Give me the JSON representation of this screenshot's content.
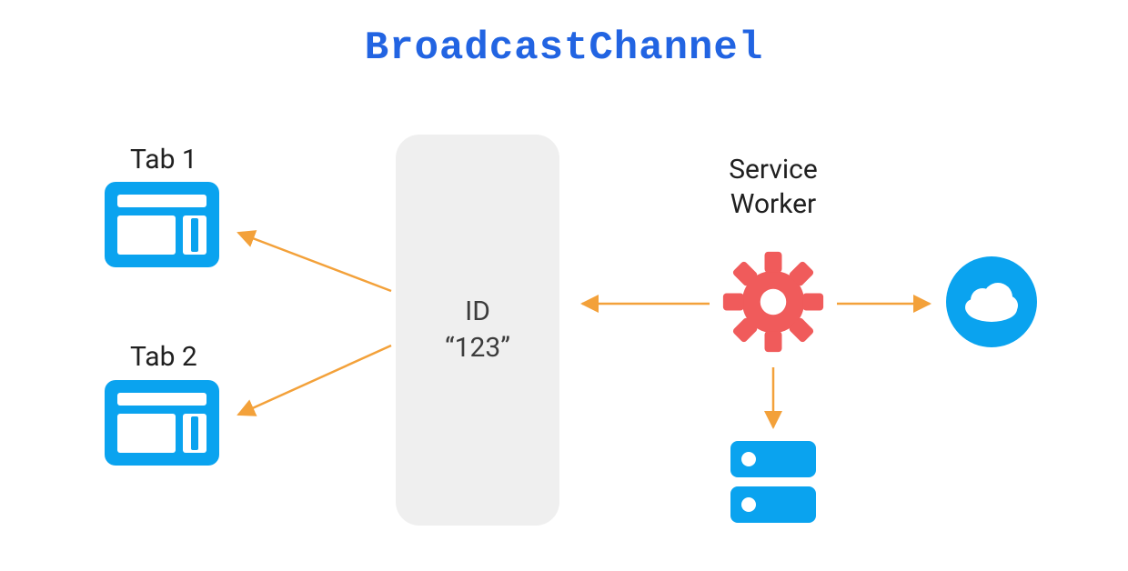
{
  "title": "BroadcastChannel",
  "channel": {
    "id_label": "ID",
    "id_value": "“123”"
  },
  "tabs": {
    "tab1_label": "Tab 1",
    "tab2_label": "Tab 2"
  },
  "service_worker": {
    "label_line1": "Service",
    "label_line2": "Worker"
  },
  "colors": {
    "title_blue": "#2264e2",
    "icon_blue": "#0aa3ef",
    "gear_red": "#f05b5b",
    "arrow_orange": "#f3a13a",
    "channel_bg": "#efefef",
    "text_dark": "#3c3c3c"
  },
  "icons": {
    "tab1": "browser-window-icon",
    "tab2": "browser-window-icon",
    "service_worker": "gear-icon",
    "cloud": "cloud-icon",
    "storage": "storage-icon"
  },
  "arrows": [
    {
      "from": "channel",
      "to": "tab1"
    },
    {
      "from": "channel",
      "to": "tab2"
    },
    {
      "from": "service_worker",
      "to": "channel"
    },
    {
      "from": "service_worker",
      "to": "cloud"
    },
    {
      "from": "service_worker",
      "to": "storage"
    }
  ]
}
